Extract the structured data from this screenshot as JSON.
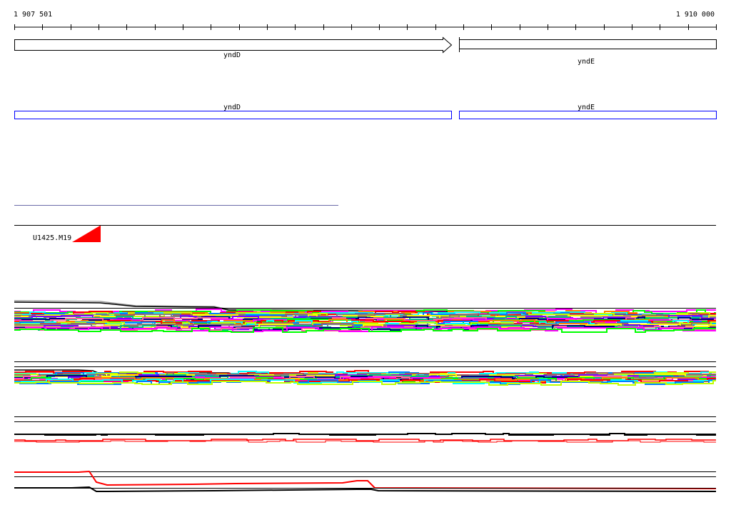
{
  "ruler": {
    "start_label": "1 907 501",
    "end_label": "1 910 000"
  },
  "genes": [
    {
      "name": "yndD",
      "strand": "+"
    },
    {
      "name": "yndE",
      "strand": "+"
    }
  ],
  "annotations": [
    {
      "name": "yndD"
    },
    {
      "name": "yndE"
    }
  ],
  "track": {
    "label": "U1425.M19"
  },
  "colors": {
    "gene_outline": "#000000",
    "annotation_outline": "#0000ff",
    "triangle": "#ff0000",
    "separator": "#6a6aa8"
  }
}
